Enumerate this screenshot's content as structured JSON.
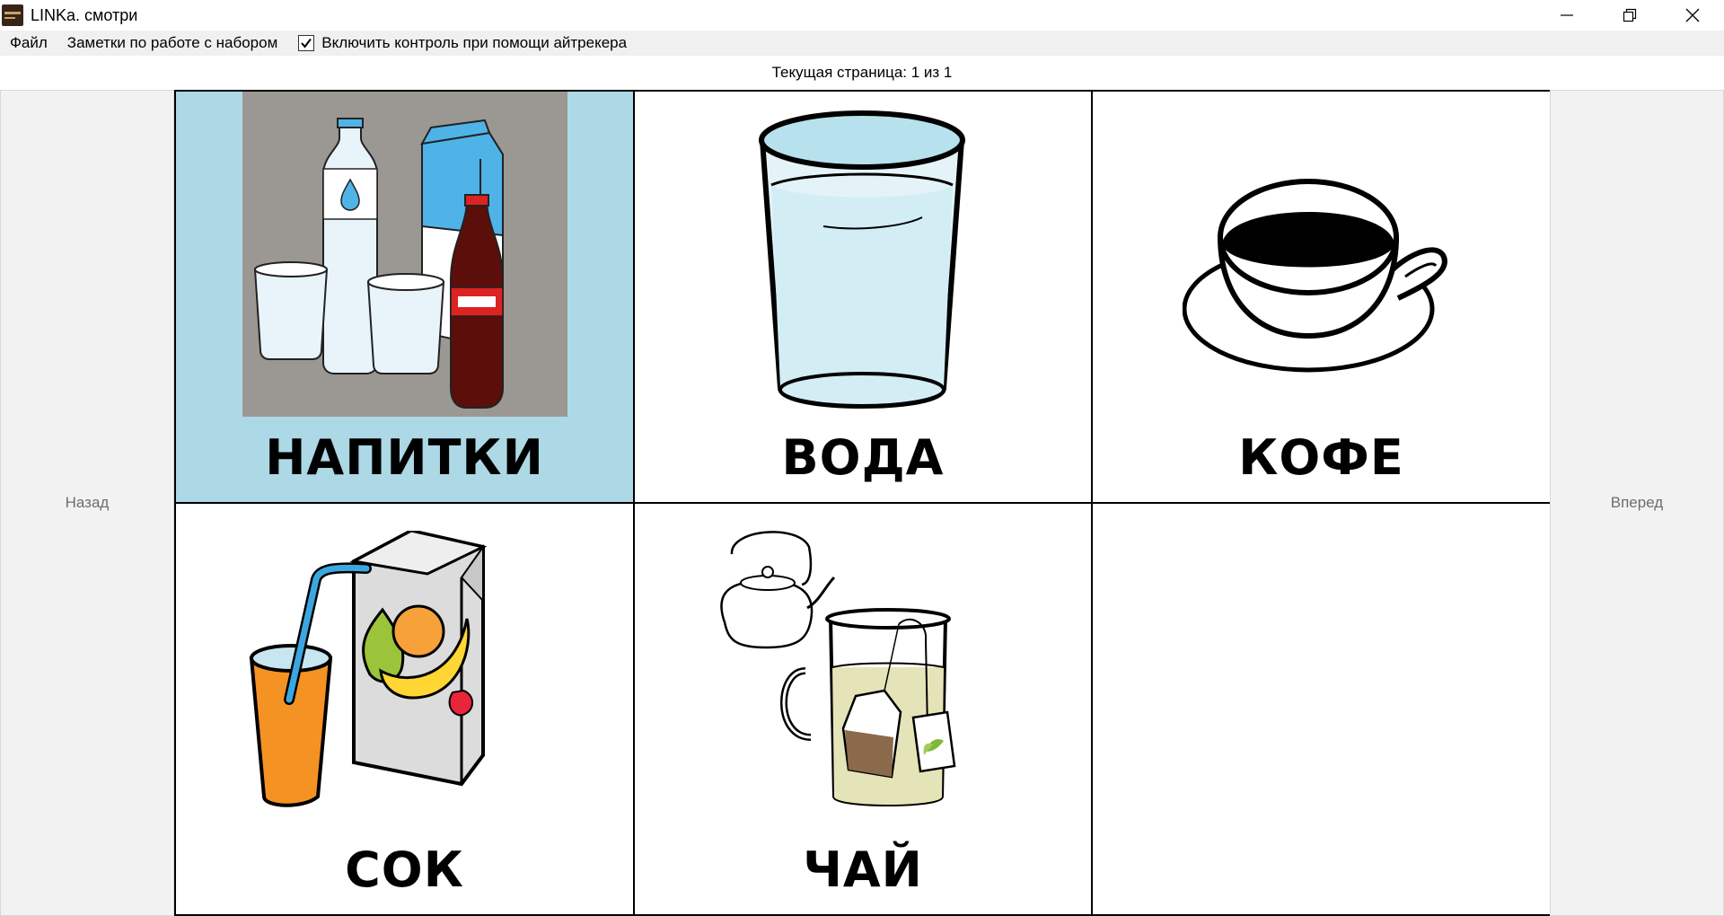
{
  "window": {
    "title": "LINKa. смотри",
    "controls": [
      "minimize-icon",
      "restore-icon",
      "close-icon"
    ]
  },
  "menu": {
    "file": "Файл",
    "notes": "Заметки по работе с набором",
    "eyetracker_label": "Включить контроль при помощи айтрекера",
    "eyetracker_checked": true
  },
  "page_indicator": "Текущая страница: 1 из 1",
  "nav": {
    "back": "Назад",
    "forward": "Вперед"
  },
  "cards": [
    {
      "label": "НАПИТКИ",
      "icon": "drinks-picture",
      "selected": true
    },
    {
      "label": "ВОДА",
      "icon": "water-glass-picture",
      "selected": false
    },
    {
      "label": "КОФЕ",
      "icon": "coffee-cup-picture",
      "selected": false
    },
    {
      "label": "СОК",
      "icon": "juice-picture",
      "selected": false
    },
    {
      "label": "ЧАЙ",
      "icon": "tea-picture",
      "selected": false
    },
    {
      "label": "",
      "icon": "",
      "selected": false
    }
  ],
  "colors": {
    "selected_card": "#add8e6",
    "nav_background": "#f2f2f2",
    "menu_background": "#f0f0f0"
  }
}
